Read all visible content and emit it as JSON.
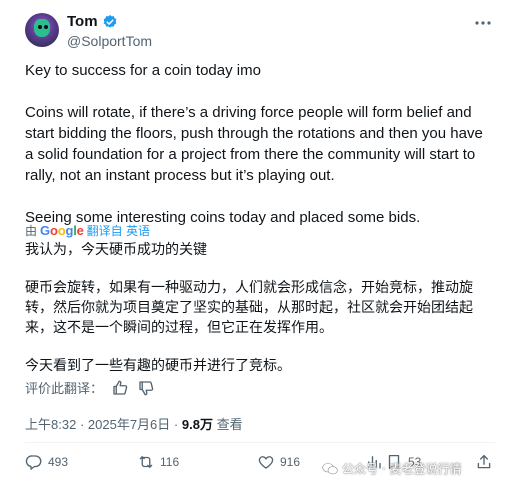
{
  "author": {
    "name": "Tom",
    "handle": "@SolportTom"
  },
  "tweet": {
    "paragraphs": [
      "Key to success for a coin today imo",
      "Coins will rotate, if there’s a driving force people will form belief and start bidding the floors, push through the rotations and then you have a solid foundation for a project from there the community will start to rally, not an instant process but it’s playing out.",
      "Seeing some interesting coins today and placed some bids."
    ]
  },
  "translation": {
    "by_prefix": "由",
    "provider": "Google",
    "link_label": "翻译自 英语",
    "paragraphs": [
      "我认为，今天硬币成功的关键",
      "硬币会旋转，如果有一种驱动力，人们就会形成信念，开始竞标，推动旋转，然后你就为项目奠定了坚实的基础，从那时起，社区就会开始团结起来，这不是一个瞬间的过程，但它正在发挥作用。",
      "今天看到了一些有趣的硬币并进行了竞标。"
    ],
    "rate_label": "评价此翻译："
  },
  "meta": {
    "time": "上午8:32",
    "sep": "·",
    "date": "2025年7月6日",
    "views": "9.8万",
    "views_label": "查看"
  },
  "actions": {
    "replies": "493",
    "reposts": "116",
    "likes": "916",
    "bookmarks": "53"
  },
  "watermark": "公众号 · 麦老登说行情",
  "colors": {
    "accent": "#1d9bf0",
    "muted": "#536471",
    "text": "#0f1419"
  }
}
